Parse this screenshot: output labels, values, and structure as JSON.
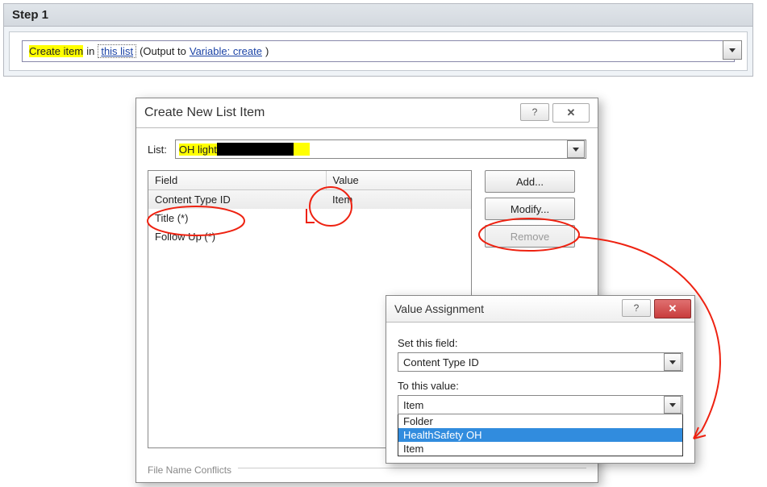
{
  "step": {
    "title": "Step 1",
    "action_hl": "Create item",
    "action_mid": " in ",
    "link_list": "this list",
    "action_after": " (Output to ",
    "link_var": "Variable: create",
    "action_end": " )"
  },
  "dlg_create": {
    "title": "Create New List Item",
    "help": "?",
    "close": "X",
    "list_label": "List:",
    "list_value_hl": "OH light",
    "col_field": "Field",
    "col_value": "Value",
    "rows": [
      {
        "field": "Content Type ID",
        "value": "Item"
      },
      {
        "field": "Title (*)",
        "value": ""
      },
      {
        "field": "Follow Up (*)",
        "value": ""
      }
    ],
    "btn_add": "Add...",
    "btn_modify": "Modify...",
    "btn_remove": "Remove",
    "conflict_label": "File Name Conflicts"
  },
  "dlg_value": {
    "title": "Value Assignment",
    "help": "?",
    "close": "X",
    "label_field": "Set this field:",
    "field_value": "Content Type ID",
    "label_value": "To this value:",
    "value_value": "Item",
    "options": [
      "Folder",
      "HealthSafety OH",
      "Item"
    ],
    "selected_option": "HealthSafety OH"
  }
}
